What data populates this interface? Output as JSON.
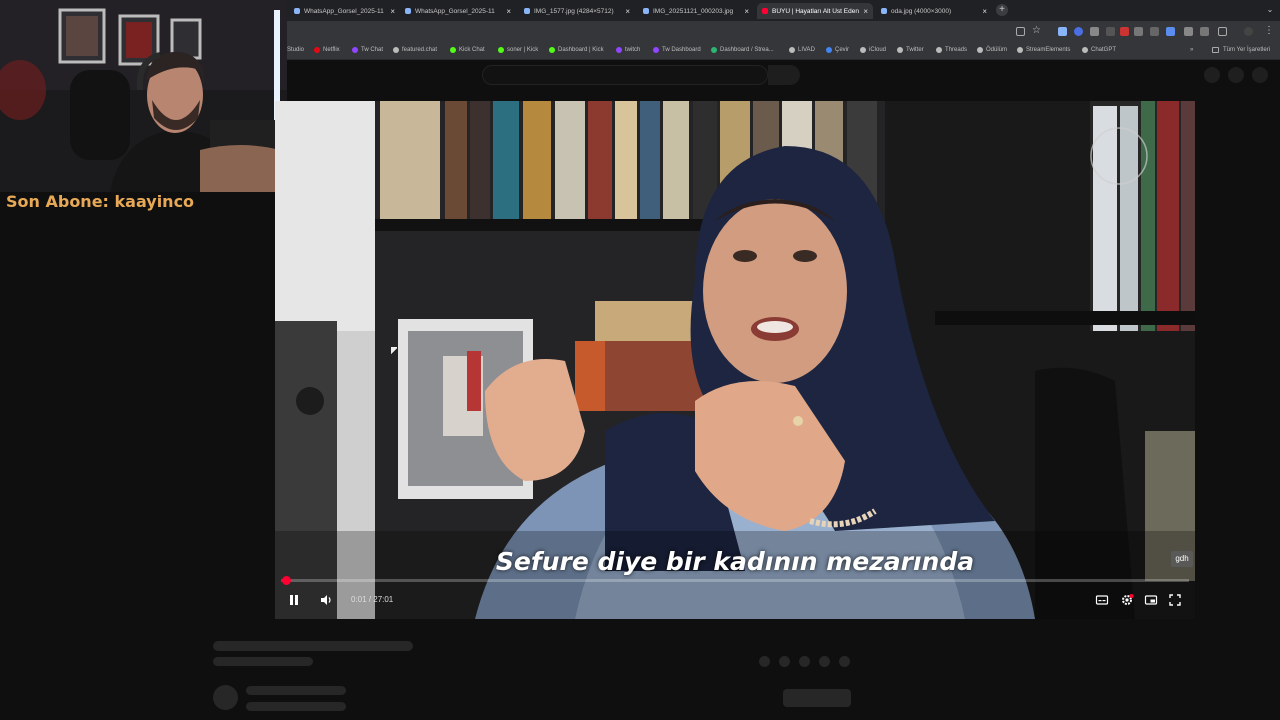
{
  "browser": {
    "tabs": [
      {
        "title": "WhatsApp_Gorsel_2025-11",
        "active": false
      },
      {
        "title": "WhatsApp_Gorsel_2025-11",
        "active": false
      },
      {
        "title": "IMG_1577.jpg (4284×5712)",
        "active": false
      },
      {
        "title": "IMG_20251121_000203.jpg",
        "active": false
      },
      {
        "title": "BÜYÜ | Hayatları Alt Üst Eden",
        "active": true
      },
      {
        "title": "oda.jpg (4000×3000)",
        "active": false
      }
    ],
    "new_tab_label": "+",
    "close_label": "×",
    "tab_menu_label": "⌄",
    "bookmarks": [
      {
        "label": "Studio",
        "color": "#9e9e9e"
      },
      {
        "label": "Netflix",
        "color": "#e50914"
      },
      {
        "label": "Tw Chat",
        "color": "#9146ff"
      },
      {
        "label": "featured.chat",
        "color": "#bbbbbb"
      },
      {
        "label": "Kick Chat",
        "color": "#53fc18"
      },
      {
        "label": "soner | Kick",
        "color": "#53fc18"
      },
      {
        "label": "Dashboard | Kick",
        "color": "#53fc18"
      },
      {
        "label": "twitch",
        "color": "#9146ff"
      },
      {
        "label": "Tw Dashboard",
        "color": "#9146ff"
      },
      {
        "label": "Dashboard / Strea...",
        "color": "#2bb673"
      },
      {
        "label": "LIVAD",
        "color": "#bbbbbb"
      },
      {
        "label": "Çevir",
        "color": "#4285f4"
      },
      {
        "label": "iCloud",
        "color": "#bbbbbb"
      },
      {
        "label": "Twitter",
        "color": "#bbbbbb"
      },
      {
        "label": "Threads",
        "color": "#bbbbbb"
      },
      {
        "label": "Ödülüm",
        "color": "#bbbbbb"
      },
      {
        "label": "StreamElements",
        "color": "#bbbbbb"
      },
      {
        "label": "ChatGPT",
        "color": "#bbbbbb"
      }
    ],
    "bookmarks_overflow": "»",
    "all_bookmarks_label": "Tüm Yer İşaretleri"
  },
  "overlay": {
    "last_subscriber": "Son Abone: kaayinco"
  },
  "video": {
    "caption": "Sefure diye bir kadının mezarında",
    "watermark": "gdh",
    "time": "0:01 / 27:01",
    "progress_fraction": 0.0006,
    "accent": "#ff0033",
    "controls": {
      "play_pause_icon": "pause-icon",
      "volume_icon": "volume-icon",
      "subtitles_icon": "subtitles-icon",
      "settings_icon": "settings-gear-icon",
      "miniplayer_icon": "miniplayer-icon",
      "fullscreen_icon": "fullscreen-icon"
    }
  }
}
